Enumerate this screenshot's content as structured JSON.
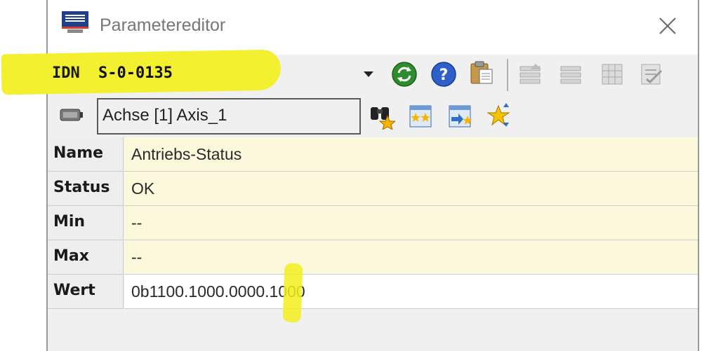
{
  "window": {
    "title": "Parametereditor"
  },
  "toolbar": {
    "idn_label": "IDN",
    "idn_value": "S-0-0135",
    "icons": [
      "refresh-icon",
      "help-icon",
      "paste-clipboard-icon",
      "move-up-icon",
      "move-down-icon",
      "grid-icon",
      "checklist-icon"
    ]
  },
  "axis": {
    "value": "Achse [1] Axis_1",
    "icons": [
      "binoculars-star-icon",
      "star-list-icon",
      "import-star-icon",
      "sort-star-icon"
    ]
  },
  "parameters": [
    {
      "label": "Name",
      "value": "Antriebs-Status"
    },
    {
      "label": "Status",
      "value": "OK"
    },
    {
      "label": "Min",
      "value": "--"
    },
    {
      "label": "Max",
      "value": "--"
    },
    {
      "label": "Wert",
      "value": "0b1100.1000.0000.1000"
    }
  ],
  "colors": {
    "highlight": "#f3f030",
    "value_background": "#fbf8dc",
    "window_background": "#f0f0f0"
  }
}
